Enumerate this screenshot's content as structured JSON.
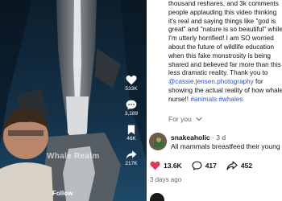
{
  "video": {
    "watermark": "Whale Realm",
    "follow_label": "Follow",
    "actions": {
      "likes": "533K",
      "comments": "3,189",
      "favorites": "46K",
      "shares": "217K"
    }
  },
  "post": {
    "caption_lines": [
      "thousand reshares, and 3k comments",
      "people applauding this video thinking",
      "it's real and saying things like \"god is",
      "great\" and \"nature is so beautiful\" while",
      "I'm utterly horrified! I am SO worried",
      "about the future of wildlife education",
      "when this fake monstrosity is being",
      "shared and believed far more than this",
      "less dramatic reality. Thank you to"
    ],
    "mention": "@cassie.jensen.photography",
    "after_mention": " for",
    "line_after": "showing the actual reality of how whales",
    "line_last_prefix": "nurse!! ",
    "hashtags": [
      "#animals",
      "#whales"
    ],
    "for_you": "For you"
  },
  "comment": {
    "username": "snakeaholic",
    "time": "3 d",
    "text": "All mammals breastfeed their young"
  },
  "stats": {
    "likes": "13.6K",
    "comments": "417",
    "shares": "452"
  },
  "date": "3 days ago",
  "colors": {
    "accent_link": "#2b54d6",
    "like_red": "#e8364f"
  }
}
